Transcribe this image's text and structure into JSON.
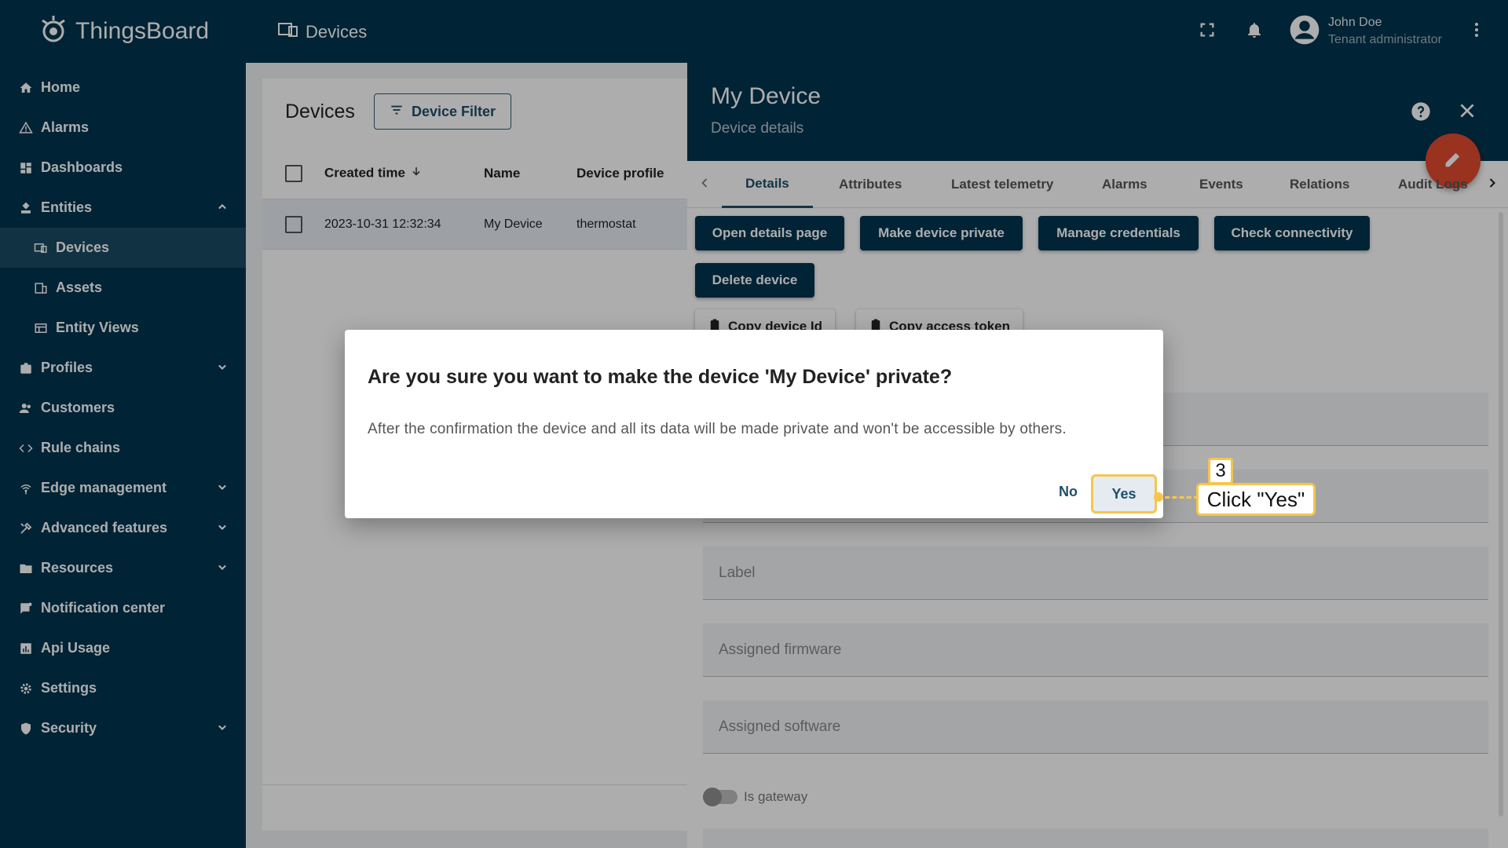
{
  "app": {
    "name": "ThingsBoard"
  },
  "header": {
    "title": "Devices",
    "user_name": "John Doe",
    "user_role": "Tenant administrator"
  },
  "sidebar": {
    "items": [
      {
        "label": "Home"
      },
      {
        "label": "Alarms"
      },
      {
        "label": "Dashboards"
      },
      {
        "label": "Entities"
      },
      {
        "label": "Devices"
      },
      {
        "label": "Assets"
      },
      {
        "label": "Entity Views"
      },
      {
        "label": "Profiles"
      },
      {
        "label": "Customers"
      },
      {
        "label": "Rule chains"
      },
      {
        "label": "Edge management"
      },
      {
        "label": "Advanced features"
      },
      {
        "label": "Resources"
      },
      {
        "label": "Notification center"
      },
      {
        "label": "Api Usage"
      },
      {
        "label": "Settings"
      },
      {
        "label": "Security"
      }
    ]
  },
  "devices": {
    "title": "Devices",
    "filter_label": "Device Filter",
    "columns": [
      "Created time",
      "Name",
      "Device profile"
    ],
    "rows": [
      {
        "created": "2023-10-31 12:32:34",
        "name": "My Device",
        "profile": "thermostat"
      }
    ]
  },
  "details": {
    "title": "My Device",
    "subtitle": "Device details",
    "tabs": [
      "Details",
      "Attributes",
      "Latest telemetry",
      "Alarms",
      "Events",
      "Relations",
      "Audit Logs"
    ],
    "buttons": [
      "Open details page",
      "Make device private",
      "Manage credentials",
      "Check connectivity",
      "Delete device"
    ],
    "copy_buttons": [
      "Copy device Id",
      "Copy access token"
    ],
    "fields": [
      "Label",
      "Assigned firmware",
      "Assigned software"
    ],
    "toggle_label": "Is gateway"
  },
  "dialog": {
    "title": "Are you sure you want to make the device 'My Device' private?",
    "message": "After the confirmation the device and all its data will be made private and won't be accessible by others.",
    "no_label": "No",
    "yes_label": "Yes"
  },
  "annotation": {
    "step": "3",
    "text": "Click \"Yes\""
  },
  "colors": {
    "primary": "#00344f",
    "accent": "#e24b2e",
    "highlight": "#f7c54c"
  }
}
